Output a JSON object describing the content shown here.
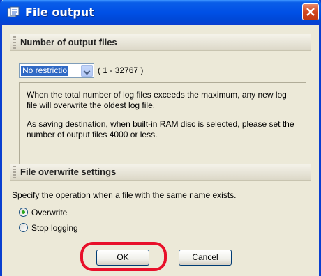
{
  "window": {
    "title": "File output",
    "accent": "#0a5ee8",
    "close_color": "#d2471f"
  },
  "output_files": {
    "header": "Number of output files",
    "select_value": "No restrictio",
    "range": "( 1 - 32767 )",
    "info": [
      "When the total number of log files exceeds the maximum, any new log file will overwrite the oldest log file.",
      "As saving destination, when built-in RAM disc is selected, please set the number of output files 4000 or less."
    ]
  },
  "overwrite": {
    "header": "File overwrite settings",
    "description": "Specify the operation when a file with the same name exists.",
    "options": [
      {
        "label": "Overwrite",
        "checked": true
      },
      {
        "label": "Stop logging",
        "checked": false
      }
    ]
  },
  "buttons": {
    "ok": "OK",
    "cancel": "Cancel"
  },
  "annotation": {
    "highlight_color": "#e8102a"
  }
}
